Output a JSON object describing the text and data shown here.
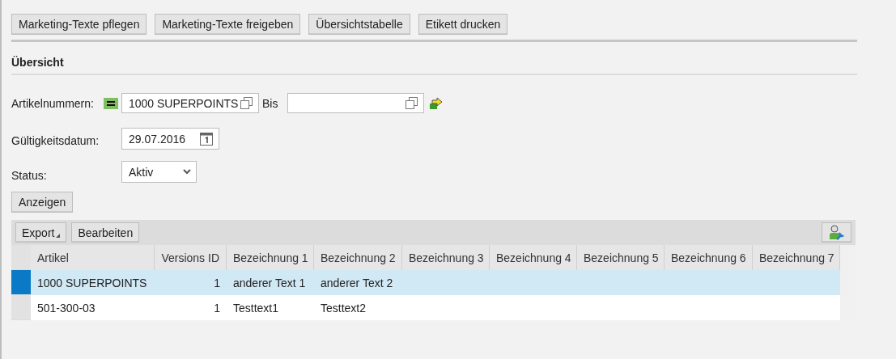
{
  "toolbar": {
    "buttons": [
      "Marketing-Texte pflegen",
      "Marketing-Texte freigeben",
      "Übersichtstabelle",
      "Etikett drucken"
    ]
  },
  "section": {
    "title": "Übersicht"
  },
  "form": {
    "article": {
      "label": "Artikelnummern:",
      "from": "1000 SUPERPOINTS",
      "to_label": "Bis"
    },
    "date": {
      "label": "Gültigkeitsdatum:",
      "value": "29.07.2016"
    },
    "status": {
      "label": "Status:",
      "value": "Aktiv"
    },
    "submit": "Anzeigen"
  },
  "table": {
    "toolbar": {
      "export": "Export",
      "edit": "Bearbeiten"
    },
    "columns": [
      "Artikel",
      "Versions ID",
      "Bezeichnung 1",
      "Bezeichnung 2",
      "Bezeichnung 3",
      "Bezeichnung 4",
      "Bezeichnung 5",
      "Bezeichnung 6",
      "Bezeichnung 7"
    ],
    "rows": [
      {
        "selected": true,
        "cells": [
          "1000 SUPERPOINTS",
          "1",
          "anderer Text 1",
          "anderer Text 2"
        ]
      },
      {
        "selected": false,
        "cells": [
          "501-300-03",
          "1",
          "Testtext1",
          "Testtext2"
        ]
      }
    ]
  }
}
